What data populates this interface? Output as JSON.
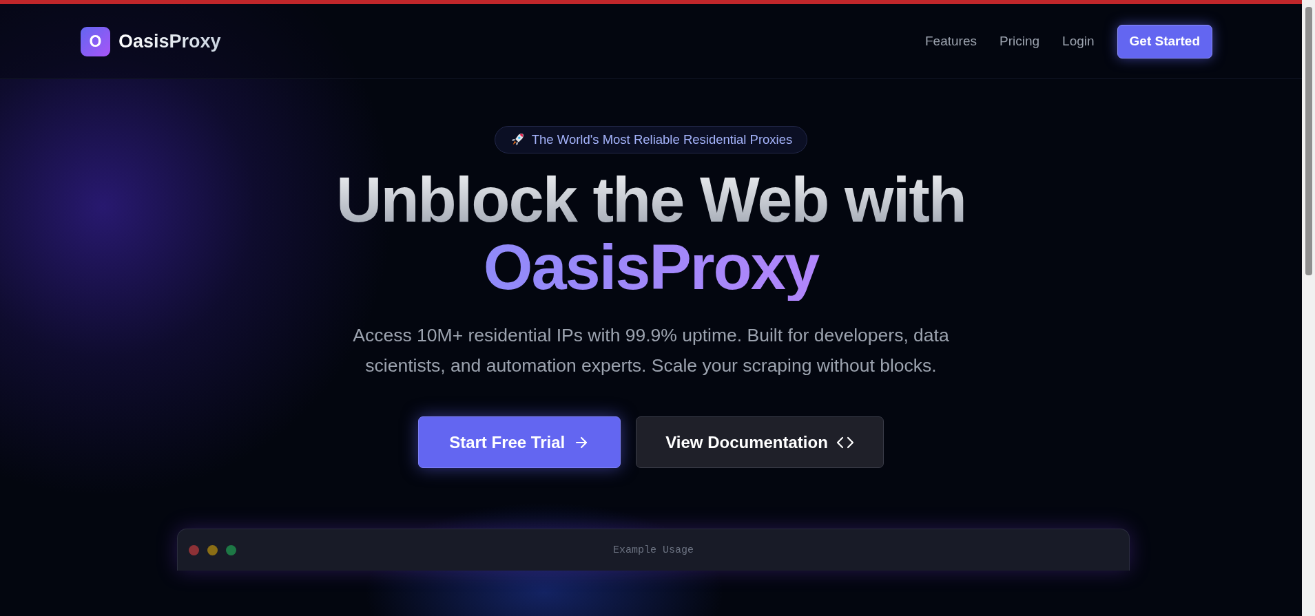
{
  "nav": {
    "logo_letter": "O",
    "brand": "OasisProxy",
    "links": [
      {
        "label": "Features"
      },
      {
        "label": "Pricing"
      },
      {
        "label": "Login"
      }
    ],
    "cta": "Get Started"
  },
  "hero": {
    "badge": "The World's Most Reliable Residential Proxies",
    "title_line": "Unblock the Web with",
    "title_accent": "OasisProxy",
    "description": "Access 10M+ residential IPs with 99.9% uptime. Built for developers, data scientists, and automation experts. Scale your scraping without blocks.",
    "buttons": [
      {
        "label": "Start Free Trial",
        "kind": "primary"
      },
      {
        "label": "View Documentation",
        "kind": "secondary"
      }
    ]
  },
  "code_window": {
    "title": "Example Usage"
  }
}
